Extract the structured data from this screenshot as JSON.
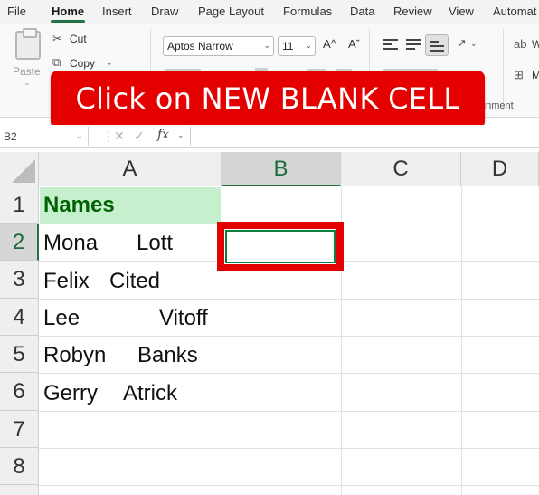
{
  "menu": {
    "tabs": [
      "File",
      "Home",
      "Insert",
      "Draw",
      "Page Layout",
      "Formulas",
      "Data",
      "Review",
      "View",
      "Automat"
    ],
    "active": "Home"
  },
  "ribbon": {
    "paste_label": "Paste",
    "cut_label": "Cut",
    "copy_label": "Copy",
    "font_name": "Aptos Narrow",
    "font_size": "11",
    "grow_font": "A^",
    "shrink_font": "Aˇ",
    "alignment_group_label": "gnment",
    "wrap_label_partial": "W",
    "merge_label_partial": "M"
  },
  "callout": {
    "text": "Click on NEW BLANK CELL",
    "color": "#e50000"
  },
  "formula_bar": {
    "name_box": "B2",
    "cancel_glyph": "✕",
    "enter_glyph": "✓",
    "fx_label": "fx",
    "content": ""
  },
  "sheet": {
    "columns": [
      "A",
      "B",
      "C",
      "D"
    ],
    "rows": [
      "1",
      "2",
      "3",
      "4",
      "5",
      "6",
      "7",
      "8"
    ],
    "selected_cell": "B2",
    "header": "Names",
    "names": [
      [
        "Mona",
        "Lott"
      ],
      [
        "Felix",
        "Cited"
      ],
      [
        "Lee",
        "Vitoff"
      ],
      [
        "Robyn",
        "Banks"
      ],
      [
        "Gerry",
        "Atrick"
      ]
    ],
    "header_fill": "#c6efce",
    "header_text_color": "#006100",
    "highlight_color": "#e30000"
  }
}
